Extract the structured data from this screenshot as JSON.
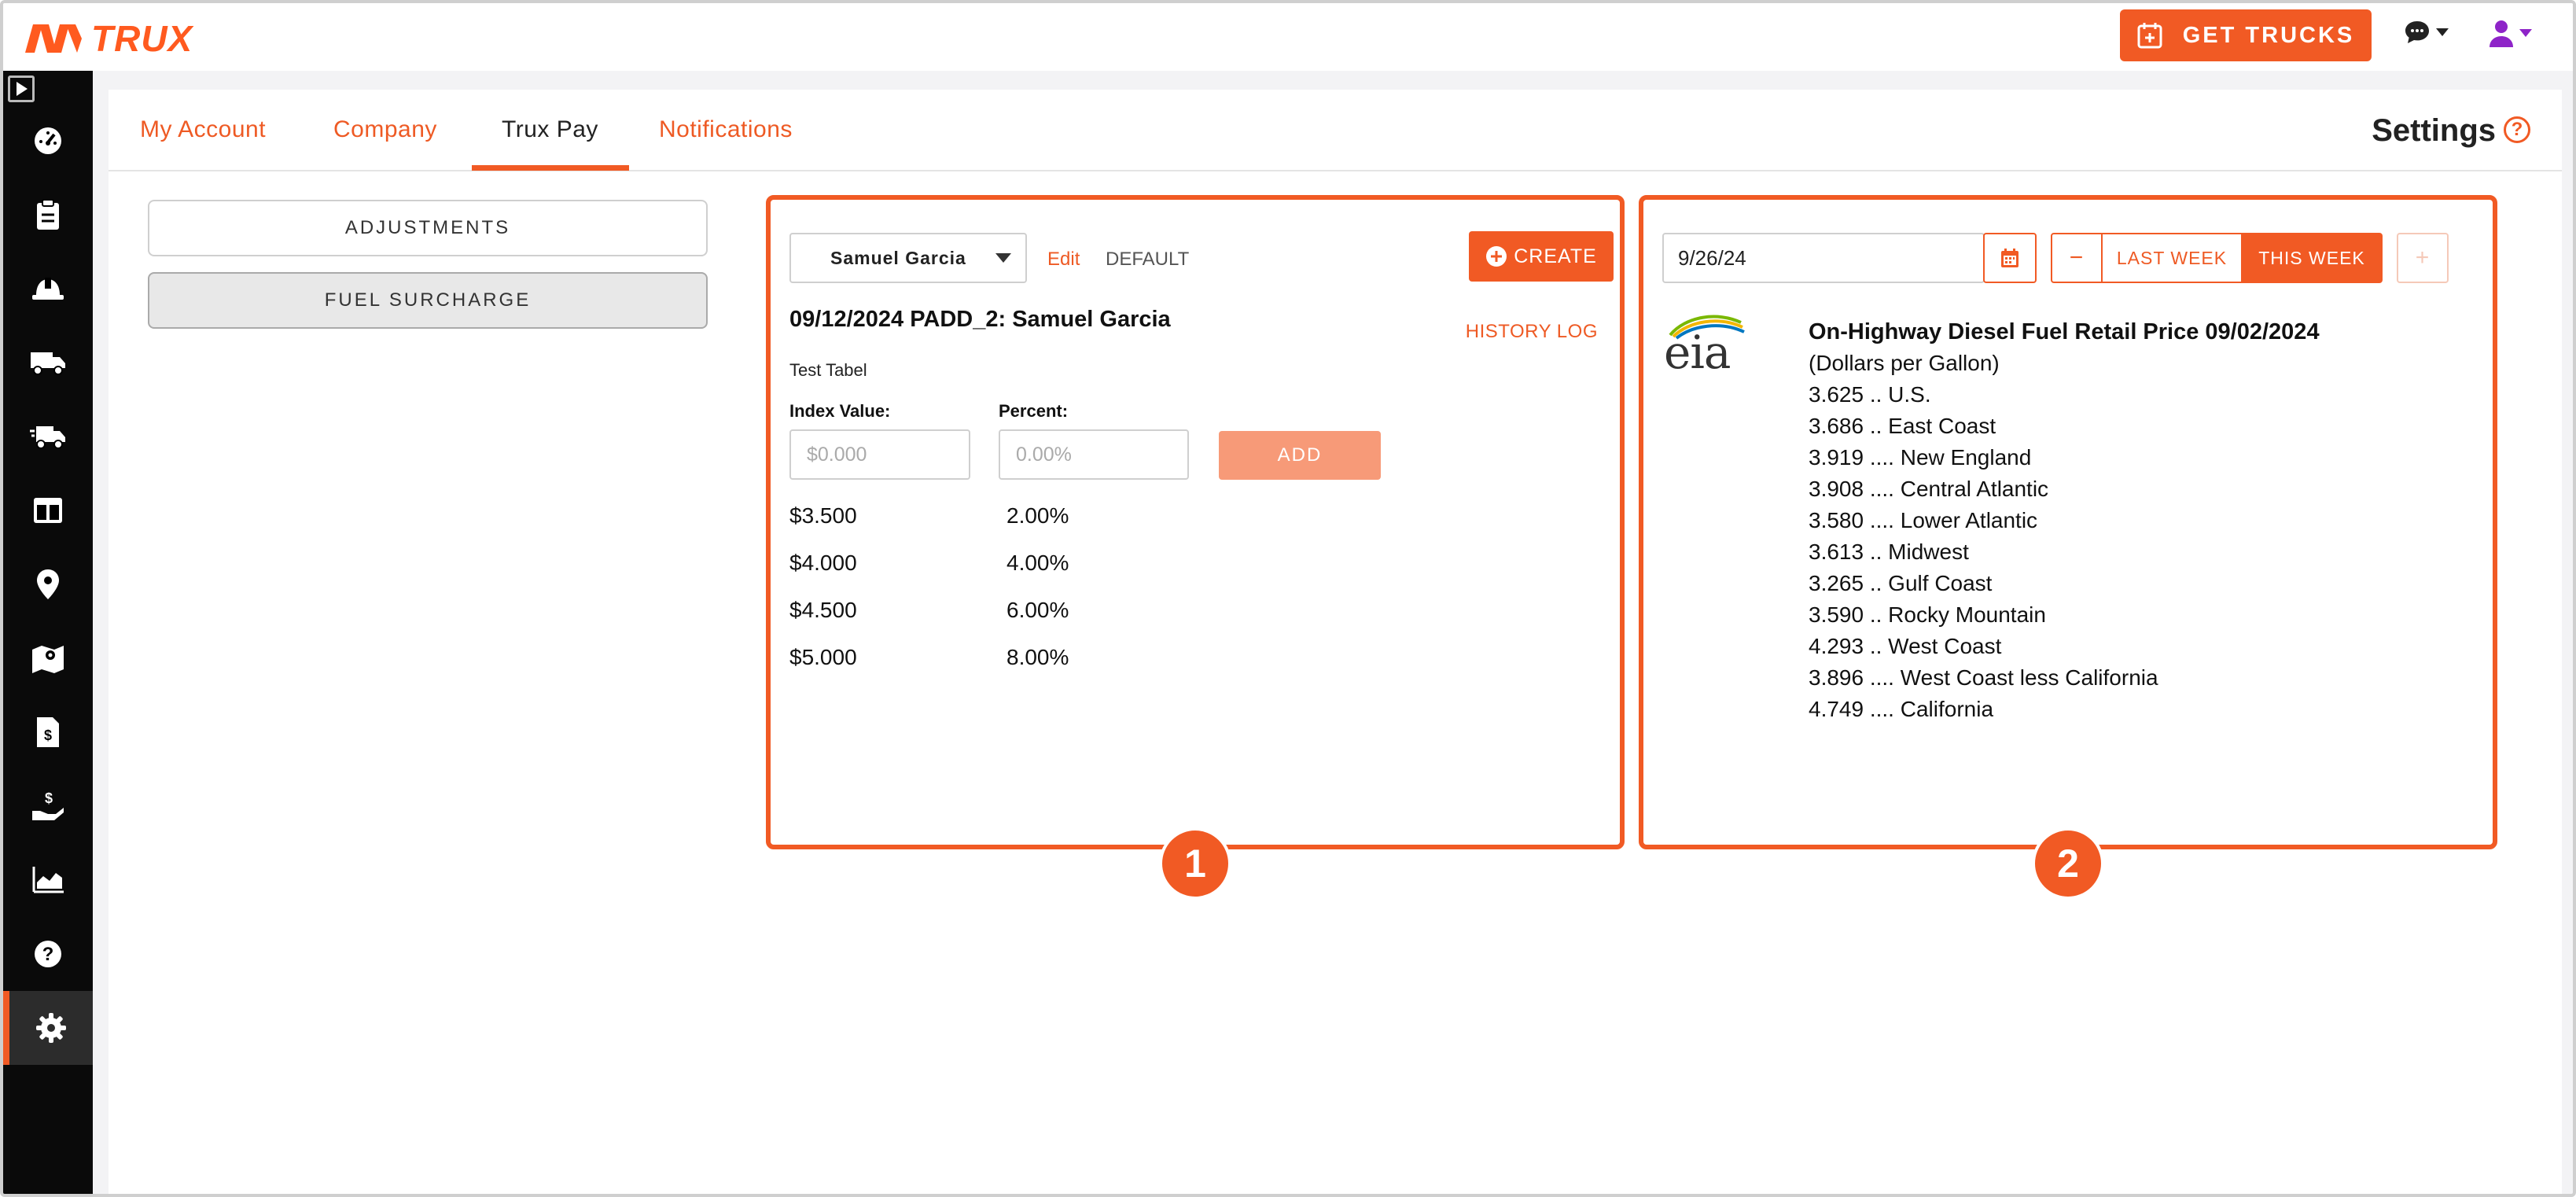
{
  "brand": {
    "name": "TRUX"
  },
  "header": {
    "get_trucks_label": "GET TRUCKS"
  },
  "tabs": [
    {
      "label": "My Account"
    },
    {
      "label": "Company"
    },
    {
      "label": "Trux Pay"
    },
    {
      "label": "Notifications"
    }
  ],
  "page_title": "Settings",
  "left_menu": {
    "adjustments": "ADJUSTMENTS",
    "fuel_surcharge": "FUEL SURCHARGE"
  },
  "panel1": {
    "badge": "1",
    "selected_driver": "Samuel Garcia",
    "edit_label": "Edit",
    "default_label": "DEFAULT",
    "create_label": "CREATE",
    "table_title": "09/12/2024 PADD_2: Samuel Garcia",
    "history_label": "HISTORY LOG",
    "table_name": "Test Tabel",
    "index_label": "Index Value:",
    "percent_label": "Percent:",
    "index_placeholder": "$0.000",
    "percent_placeholder": "0.00%",
    "add_label": "ADD",
    "rows": [
      {
        "index": "$3.500",
        "percent": "2.00%"
      },
      {
        "index": "$4.000",
        "percent": "4.00%"
      },
      {
        "index": "$4.500",
        "percent": "6.00%"
      },
      {
        "index": "$5.000",
        "percent": "8.00%"
      }
    ]
  },
  "panel2": {
    "badge": "2",
    "date_value": "9/26/24",
    "minus_label": "−",
    "last_week_label": "LAST WEEK",
    "this_week_label": "THIS WEEK",
    "plus_label": "+",
    "logo_text": "eia",
    "fuel_title": "On-Highway Diesel Fuel Retail Price 09/02/2024",
    "fuel_lines": [
      "(Dollars per Gallon)",
      "3.625 .. U.S.",
      "3.686 .. East Coast",
      "3.919 .... New England",
      "3.908 .... Central Atlantic",
      "3.580 .... Lower Atlantic",
      "3.613 .. Midwest",
      "3.265 .. Gulf Coast",
      "3.590 .. Rocky Mountain",
      "4.293 .. West Coast",
      "3.896 .... West Coast less California",
      "4.749 .... California"
    ]
  },
  "colors": {
    "accent": "#f15a24",
    "sidebar": "#0a0a0a",
    "user_icon": "#8e24c8"
  },
  "sidebar_icons": [
    "expand-icon",
    "dashboard-icon",
    "clipboard-icon",
    "hardhat-icon",
    "truck-icon",
    "fast-truck-icon",
    "columns-icon",
    "location-pin-icon",
    "map-icon",
    "invoice-icon",
    "payment-hand-icon",
    "chart-icon",
    "help-icon",
    "gear-icon"
  ]
}
